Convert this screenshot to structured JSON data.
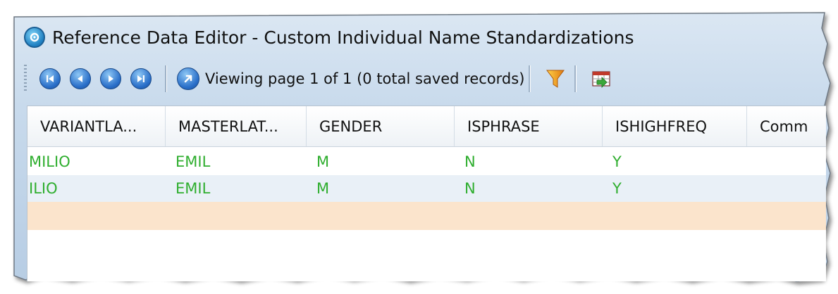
{
  "window": {
    "title": "Reference Data Editor - Custom Individual Name Standardizations"
  },
  "toolbar": {
    "nav_buttons": [
      "first-page-icon",
      "previous-page-icon",
      "next-page-icon",
      "last-page-icon"
    ],
    "goto_icon": "go-to-page-icon",
    "status": "Viewing page 1 of 1 (0 total saved records)",
    "filter_icon": "filter-funnel-icon",
    "export_icon": "export-grid-icon"
  },
  "grid": {
    "columns": [
      "VARIANTLA...",
      "MASTERLAT...",
      "GENDER",
      "ISPHRASE",
      "ISHIGHFREQ",
      "Comm"
    ],
    "rows": [
      [
        "MILIO",
        "EMIL",
        "M",
        "N",
        "Y",
        ""
      ],
      [
        "ILIO",
        "EMIL",
        "M",
        "N",
        "Y",
        ""
      ]
    ],
    "new_row_color": "#fbe4cc",
    "value_color": "#2fae2f"
  },
  "colors": {
    "frame_border": "#7f8a96",
    "header_gradient_top": "#d7e4f1",
    "header_gradient_bottom": "#b9cfe6"
  }
}
